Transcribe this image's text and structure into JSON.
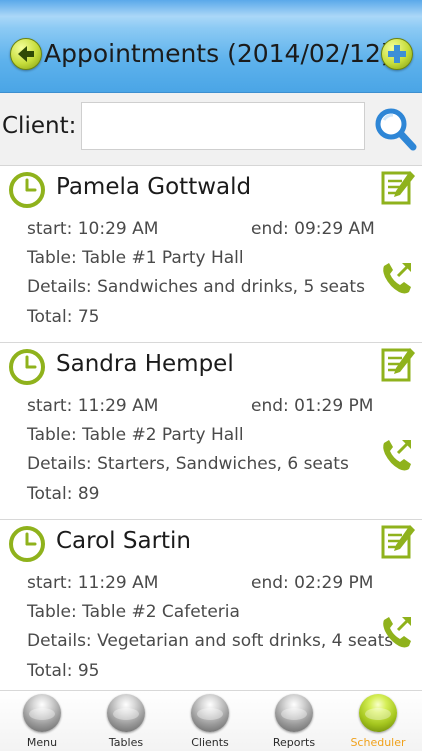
{
  "header": {
    "title": "Appointments (2014/02/12)",
    "prev_icon": "arrow-left-icon",
    "next_icon": "plus-icon"
  },
  "search": {
    "label": "Client:",
    "value": "",
    "placeholder": "",
    "icon": "search-icon"
  },
  "appointments": [
    {
      "name": "Pamela Gottwald",
      "start": "start: 10:29 AM",
      "end": "end: 09:29 AM",
      "table": "Table: Table #1 Party Hall",
      "details": "Details: Sandwiches and drinks, 5 seats",
      "total": "Total: 75"
    },
    {
      "name": "Sandra Hempel",
      "start": "start: 11:29 AM",
      "end": "end: 01:29 PM",
      "table": "Table: Table #2 Party Hall",
      "details": "Details: Starters, Sandwiches, 6 seats",
      "total": "Total: 89"
    },
    {
      "name": "Carol Sartin",
      "start": "start: 11:29 AM",
      "end": "end: 02:29 PM",
      "table": "Table: Table #2 Cafeteria",
      "details": "Details: Vegetarian and soft drinks, 4 seats",
      "total": "Total: 95"
    }
  ],
  "tabs": [
    {
      "label": "Menu",
      "active": false
    },
    {
      "label": "Tables",
      "active": false
    },
    {
      "label": "Clients",
      "active": false
    },
    {
      "label": "Reports",
      "active": false
    },
    {
      "label": "Scheduler",
      "active": true
    }
  ],
  "colors": {
    "header_blue": "#5eb2ec",
    "icon_green": "#8fb21c",
    "active_tab": "#f0a11b"
  }
}
